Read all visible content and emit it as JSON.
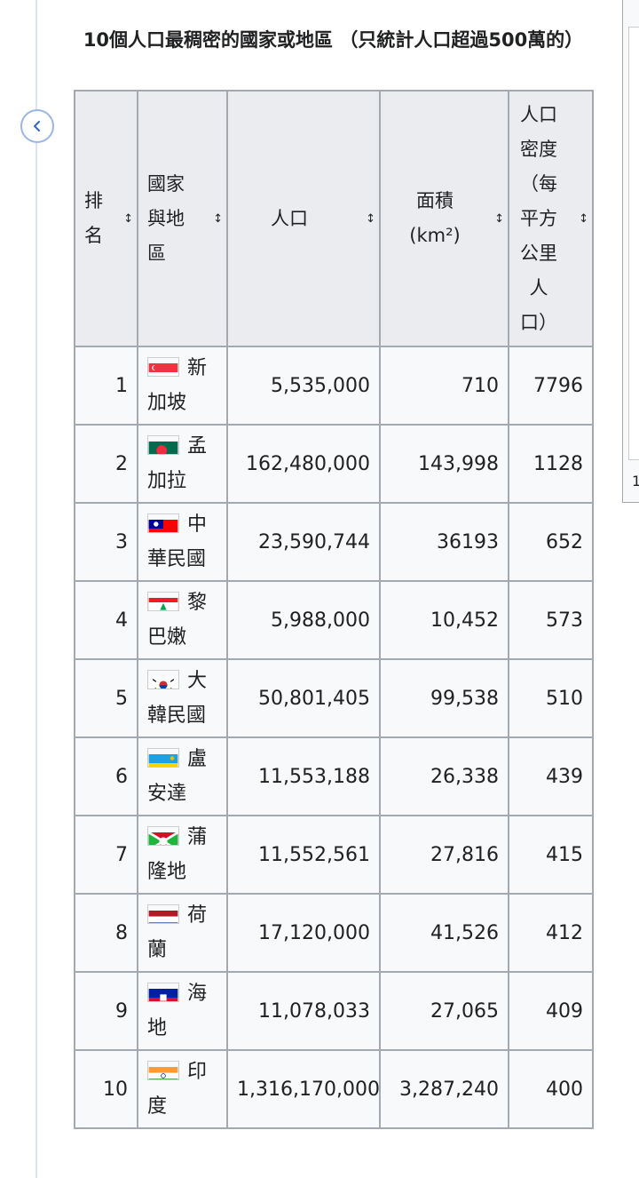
{
  "caption": "10個人口最稠密的國家或地區 （只統計人口超過500萬的）",
  "headers": {
    "rank": "排名",
    "country": "國家與地區",
    "population": "人口",
    "area": "面積(km²)",
    "density": "人口密度（每平方公里人口）"
  },
  "sort_icon": "↕",
  "rows": [
    {
      "rank": "1",
      "country": "新加坡",
      "population": "5,535,000",
      "area": "710",
      "density": "7796",
      "flag": "singapore-flag"
    },
    {
      "rank": "2",
      "country": "孟加拉",
      "population": "162,480,000",
      "area": "143,998",
      "density": "1128",
      "flag": "bangladesh-flag"
    },
    {
      "rank": "3",
      "country": "中華民國",
      "population": "23,590,744",
      "area": "36193",
      "density": "652",
      "flag": "taiwan-flag"
    },
    {
      "rank": "4",
      "country": "黎巴嫩",
      "population": "5,988,000",
      "area": "10,452",
      "density": "573",
      "flag": "lebanon-flag"
    },
    {
      "rank": "5",
      "country": "大韓民國",
      "population": "50,801,405",
      "area": "99,538",
      "density": "510",
      "flag": "south-korea-flag"
    },
    {
      "rank": "6",
      "country": "盧安達",
      "population": "11,553,188",
      "area": "26,338",
      "density": "439",
      "flag": "rwanda-flag"
    },
    {
      "rank": "7",
      "country": "蒲隆地",
      "population": "11,552,561",
      "area": "27,816",
      "density": "415",
      "flag": "burundi-flag"
    },
    {
      "rank": "8",
      "country": "荷蘭",
      "population": "17,120,000",
      "area": "41,526",
      "density": "412",
      "flag": "netherlands-flag"
    },
    {
      "rank": "9",
      "country": "海地",
      "population": "11,078,033",
      "area": "27,065",
      "density": "409",
      "flag": "haiti-flag"
    },
    {
      "rank": "10",
      "country": "印度",
      "population": "1,316,170,000",
      "area": "3,287,240",
      "density": "400",
      "flag": "india-flag"
    }
  ],
  "side_panel": {
    "partial_number": "1"
  },
  "colors": {
    "header_bg": "#eaecf0",
    "cell_bg": "#f8f9fa",
    "border": "#a2a9b1",
    "back_button": "#3366cc"
  }
}
